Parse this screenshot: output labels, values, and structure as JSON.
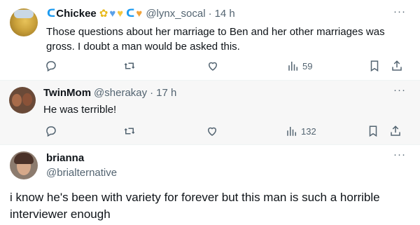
{
  "tweets": [
    {
      "name": "Chickee",
      "name_glyphs": [
        "🌻",
        "💙",
        "💛"
      ],
      "name_glyphs_2": [
        "🧡"
      ],
      "handle": "@lynx_socal",
      "time_sep": "·",
      "time": "14 h",
      "text": "Those questions about her marriage to Ben and her other marriages was gross. I doubt a man would be asked this.",
      "views": "59",
      "more": "···"
    },
    {
      "name": "TwinMom",
      "handle": "@sherakay",
      "time_sep": "·",
      "time": "17 h",
      "text": "He was terrible!",
      "views": "132",
      "more": "···"
    },
    {
      "name": "brianna",
      "handle": "@brialternative",
      "text": "i know he's been with variety for forever but this man is such a horrible interviewer enough",
      "more": "···"
    }
  ],
  "icons": {
    "reply": "reply-icon",
    "retweet": "retweet-icon",
    "like": "heart-icon",
    "views": "views-icon",
    "bookmark": "bookmark-icon",
    "share": "share-icon"
  },
  "colors": {
    "text": "#0f1419",
    "secondary": "#536471",
    "highlight_bg": "#f7f7f7",
    "accent": "#1d9bf0"
  }
}
